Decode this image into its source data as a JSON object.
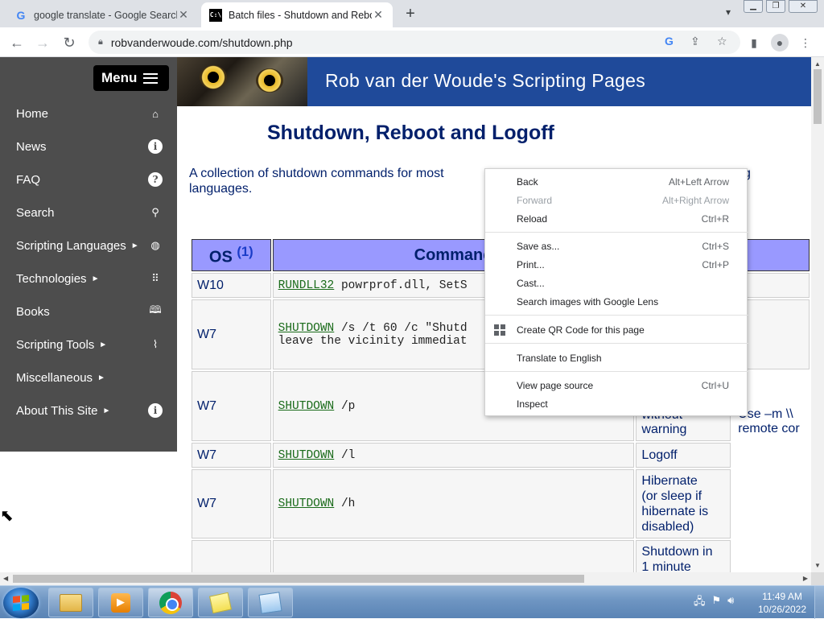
{
  "tabs": [
    {
      "title": "google translate - Google Search",
      "favicon": "google-icon",
      "active": false
    },
    {
      "title": "Batch files - Shutdown and Reboo",
      "favicon": "cmd-icon",
      "active": true
    }
  ],
  "toolbar": {
    "url": "robvanderwoude.com/shutdown.php"
  },
  "sidebar": {
    "menu_label": "Menu",
    "items": [
      {
        "label": "Home",
        "icon": "home-icon",
        "submenu": false
      },
      {
        "label": "News",
        "icon": "info-icon",
        "submenu": false
      },
      {
        "label": "FAQ",
        "icon": "question-icon",
        "submenu": false
      },
      {
        "label": "Search",
        "icon": "search-icon",
        "submenu": false
      },
      {
        "label": "Scripting Languages",
        "icon": "globe-icon",
        "submenu": true
      },
      {
        "label": "Technologies",
        "icon": "grid-icon",
        "submenu": true
      },
      {
        "label": "Books",
        "icon": "book-icon",
        "submenu": false
      },
      {
        "label": "Scripting Tools",
        "icon": "paperclip-icon",
        "submenu": true
      },
      {
        "label": "Miscellaneous",
        "icon": "",
        "submenu": true
      },
      {
        "label": "About This Site",
        "icon": "info-icon",
        "submenu": true
      }
    ],
    "arrow": "►"
  },
  "banner": {
    "title": "Rob van der Woude's Scripting Pages"
  },
  "page": {
    "heading": "Shutdown, Reboot and Logoff",
    "intro_line1": "A collection of shutdown commands for most",
    "intro_line1_tail": "g",
    "intro_line2": "languages."
  },
  "table": {
    "headers": {
      "os": "OS",
      "os_note": "(1)",
      "command": "Command"
    },
    "rows": [
      {
        "os": "W10",
        "cmd": "RUNDLL32",
        "args": " powrprof.dll, SetS",
        "desc": "",
        "desc2": ""
      },
      {
        "os": "W7",
        "cmd": "SHUTDOWN",
        "args": " /s /t 60 /c \"Shutd",
        "args2": "leave the vicinity immediat",
        "desc": "",
        "desc2": ""
      },
      {
        "os": "W7",
        "cmd": "SHUTDOWN",
        "args": " /p",
        "desc": "without\nwarning",
        "desc2": "Use –m \\\\\nremote cor"
      },
      {
        "os": "W7",
        "cmd": "SHUTDOWN",
        "args": " /l",
        "desc": "Logoff",
        "desc2": ""
      },
      {
        "os": "W7",
        "cmd": "SHUTDOWN",
        "args": " /h",
        "desc": "Hibernate\n(or sleep if\nhibernate is\ndisabled)",
        "desc2": ""
      },
      {
        "os": "",
        "cmd": "",
        "args": "",
        "desc": "Shutdown in\n1 minute",
        "desc2": ""
      }
    ]
  },
  "context_menu": {
    "items": [
      {
        "label": "Back",
        "shortcut": "Alt+Left Arrow",
        "disabled": false
      },
      {
        "label": "Forward",
        "shortcut": "Alt+Right Arrow",
        "disabled": true
      },
      {
        "label": "Reload",
        "shortcut": "Ctrl+R",
        "disabled": false
      },
      {
        "label": "Save as...",
        "shortcut": "Ctrl+S",
        "disabled": false
      },
      {
        "label": "Print...",
        "shortcut": "Ctrl+P",
        "disabled": false
      },
      {
        "label": "Cast...",
        "shortcut": "",
        "disabled": false
      },
      {
        "label": "Search images with Google Lens",
        "shortcut": "",
        "disabled": false
      },
      {
        "label": "Create QR Code for this page",
        "shortcut": "",
        "disabled": false
      },
      {
        "label": "Translate to English",
        "shortcut": "",
        "disabled": false
      },
      {
        "label": "View page source",
        "shortcut": "Ctrl+U",
        "disabled": false
      },
      {
        "label": "Inspect",
        "shortcut": "",
        "disabled": false
      }
    ]
  },
  "taskbar": {
    "time": "11:49 AM",
    "date": "10/26/2022"
  },
  "colors": {
    "banner": "#1f4a9a",
    "sidebar": "#4d4d4d",
    "table_header": "#9999ff",
    "heading_text": "#001f6b"
  }
}
